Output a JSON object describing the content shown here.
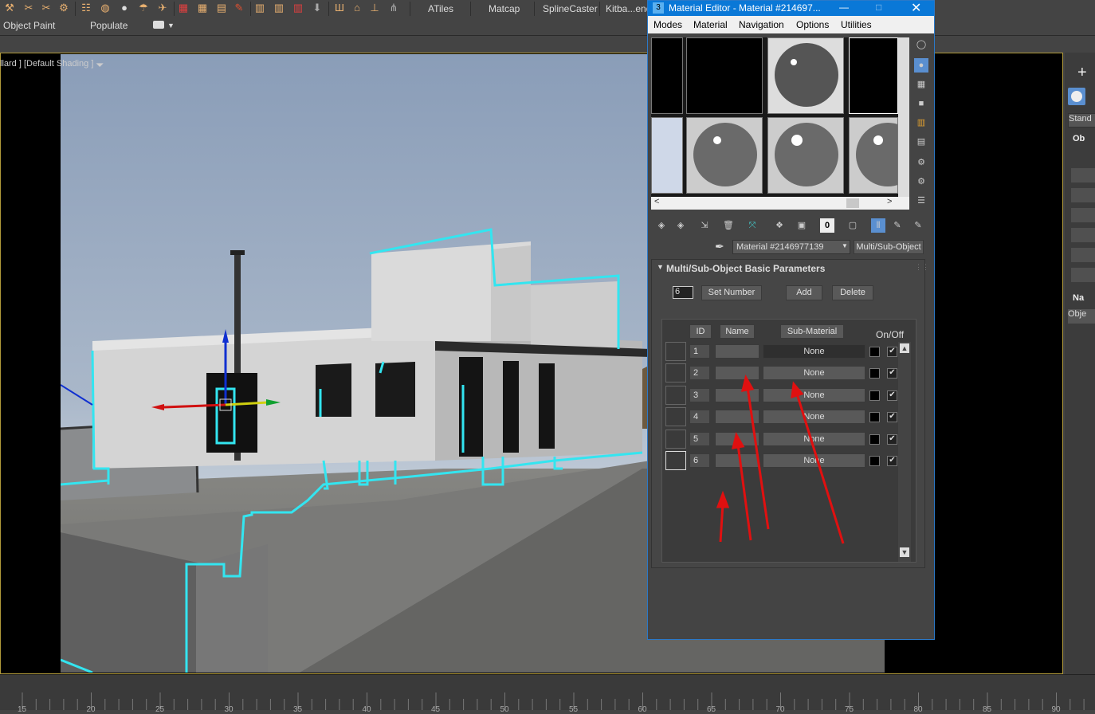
{
  "toolbar": {
    "tabs": [
      "ATiles",
      "Matcap",
      "SplineCaster",
      "Kitba...end"
    ]
  },
  "ribbon": {
    "object_paint": "Object Paint",
    "populate": "Populate"
  },
  "viewport": {
    "label": "llard ] [Default Shading ]"
  },
  "command_panel": {
    "dropdown": "Stand",
    "rollout_1": "Ob",
    "rollout_2": "Na",
    "name_field": "Obje"
  },
  "timeline": {
    "ticks": [
      "15",
      "20",
      "25",
      "30",
      "35",
      "40",
      "45",
      "50",
      "55",
      "60",
      "65",
      "70",
      "75",
      "80",
      "85",
      "90"
    ]
  },
  "material_editor": {
    "title": "Material Editor - Material #214697...",
    "menu": [
      "Modes",
      "Material",
      "Navigation",
      "Options",
      "Utilities"
    ],
    "material_name": "Material #2146977139",
    "material_type": "Multi/Sub-Object",
    "rollout_title": "Multi/Sub-Object Basic Parameters",
    "set_number_value": "6",
    "set_number_label": "Set Number",
    "add_label": "Add",
    "delete_label": "Delete",
    "headers": {
      "id": "ID",
      "name": "Name",
      "sub_material": "Sub-Material",
      "on_off": "On/Off"
    },
    "rows": [
      {
        "id": "1",
        "sub": "None",
        "on": "✔"
      },
      {
        "id": "2",
        "sub": "None",
        "on": "✔"
      },
      {
        "id": "3",
        "sub": "None",
        "on": "✔"
      },
      {
        "id": "4",
        "sub": "None",
        "on": "✔"
      },
      {
        "id": "5",
        "sub": "None",
        "on": "✔"
      },
      {
        "id": "6",
        "sub": "None",
        "on": "✔"
      }
    ]
  },
  "colors": {
    "title_bar": "#0a78d7",
    "highlight_outline": "#33e5f0",
    "annotation_arrow": "#e01010",
    "viewport_border": "#b19a3a"
  }
}
